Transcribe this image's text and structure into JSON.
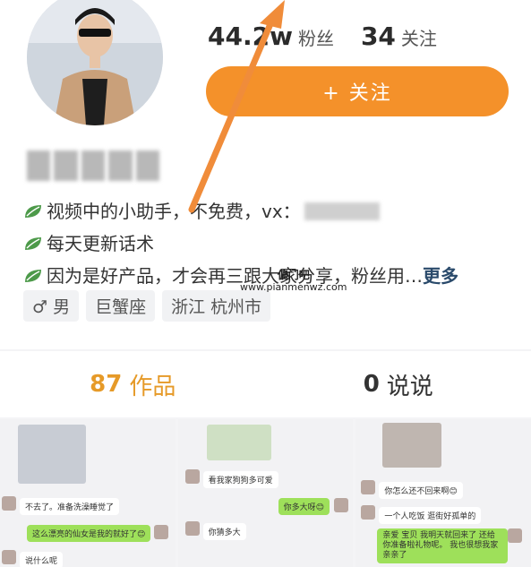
{
  "profile": {
    "stats": [
      {
        "value": "44.2w",
        "label": "粉丝"
      },
      {
        "value": "34",
        "label": "关注"
      }
    ],
    "follow_button": "+ 关注",
    "bio": [
      {
        "text": "视频中的小助手，不免费，vx："
      },
      {
        "text": "每天更新话术"
      },
      {
        "text": "因为是好产品，才会再三跟大家分享，粉丝用…",
        "more": "更多"
      }
    ],
    "tags": [
      "♂ 男",
      "巨蟹座",
      "浙江 杭州市"
    ]
  },
  "tabs": [
    {
      "count": "87",
      "label": "作品",
      "active": true
    },
    {
      "count": "0",
      "label": "说说",
      "active": false
    }
  ],
  "thumbnails": [
    {
      "messages": [
        "不去了。准备洗澡睡觉了",
        "这么漂亮的仙女是我的就好了😊",
        "说什么呢"
      ]
    },
    {
      "messages": [
        "看我家狗狗多可爱",
        "你多大呀😊",
        "你猜多大"
      ]
    },
    {
      "messages": [
        "你怎么还不回来啊😊",
        "一个人吃饭 逛街好孤单的",
        "亲爱 宝贝 我明天就回来了 还给你准备啦礼物呢。 我也很想我家亲亲了"
      ]
    }
  ],
  "watermark": {
    "cn": "偏门吧",
    "url": "www.pianmenwz.com"
  },
  "colors": {
    "accent": "#f4912a",
    "tab_active": "#e69a28",
    "arrow": "#f08c3a"
  }
}
